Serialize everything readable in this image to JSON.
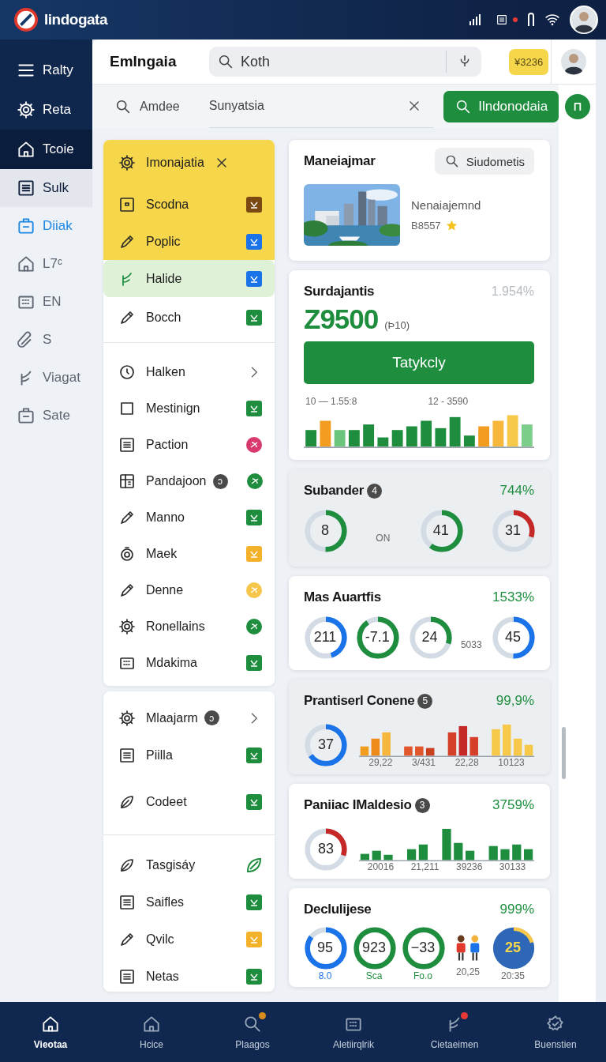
{
  "top_bar": {
    "app_name": "Iindogata"
  },
  "sidebar": {
    "sections": [
      {
        "kind": "dark",
        "items": [
          {
            "label": "Ralty",
            "selected": false,
            "highlighted": false,
            "accent": false
          },
          {
            "label": "Reta",
            "selected": false,
            "highlighted": false,
            "accent": false
          },
          {
            "label": "Tcoie",
            "selected": true,
            "highlighted": false,
            "accent": false
          }
        ]
      },
      {
        "kind": "light",
        "items": [
          {
            "label": "Sulk",
            "selected": false,
            "highlighted": true,
            "accent": false
          },
          {
            "label": "Diiak",
            "selected": false,
            "highlighted": false,
            "accent": true
          },
          {
            "label": "L7ᶜ",
            "selected": false,
            "highlighted": false,
            "accent": false
          },
          {
            "label": "EN",
            "selected": false,
            "highlighted": false,
            "accent": false
          },
          {
            "label": "S",
            "selected": false,
            "highlighted": false,
            "accent": false
          },
          {
            "label": "Viagat",
            "selected": false,
            "highlighted": false,
            "accent": false
          },
          {
            "label": "Sate",
            "selected": false,
            "highlighted": false,
            "accent": false
          }
        ]
      }
    ]
  },
  "header": {
    "title": "EmIngaia",
    "search": {
      "value": "Koth"
    },
    "badge": "¥3236"
  },
  "filter_bar": {
    "label": "Amdee",
    "field": {
      "value": "Sunyatsia"
    },
    "button": "Ilndonodaia"
  },
  "lists": [
    {
      "header": {
        "title": "Imonajatia"
      },
      "groups": [
        [
          {
            "label": "Scodna",
            "kind": "banner",
            "selected": false,
            "trail": {
              "kind": "square",
              "color": "#7a4a12"
            }
          },
          {
            "label": "Poplic",
            "kind": "banner",
            "selected": false,
            "trail": {
              "kind": "square",
              "color": "#1a73e8"
            }
          },
          {
            "label": "Halide",
            "kind": "plain",
            "selected": true,
            "trail": {
              "kind": "square",
              "color": "#1a73e8"
            }
          },
          {
            "label": "Bocch",
            "kind": "plain",
            "selected": false,
            "trail": {
              "kind": "square",
              "color": "#1e8e3e"
            }
          }
        ],
        [
          {
            "label": "Halken",
            "kind": "plain",
            "selected": false,
            "trail": {
              "kind": "chevron"
            }
          },
          {
            "label": "Mestinign",
            "kind": "plain",
            "selected": false,
            "trail": {
              "kind": "square",
              "color": "#1e8e3e"
            }
          },
          {
            "label": "Paction",
            "kind": "plain",
            "selected": false,
            "trail": {
              "kind": "circle",
              "color": "#d93a6e"
            }
          },
          {
            "label": "Pandajoon",
            "badge": "ɔ",
            "kind": "plain",
            "selected": false,
            "trail": {
              "kind": "circle",
              "color": "#1e8e3e"
            }
          },
          {
            "label": "Manno",
            "kind": "plain",
            "selected": false,
            "trail": {
              "kind": "square",
              "color": "#1e8e3e"
            }
          },
          {
            "label": "Maek",
            "kind": "plain",
            "selected": false,
            "trail": {
              "kind": "square",
              "color": "#f4b22b"
            }
          },
          {
            "label": "Denne",
            "kind": "plain",
            "selected": false,
            "trail": {
              "kind": "circle",
              "color": "#f6c64a"
            }
          },
          {
            "label": "Ronellains",
            "kind": "plain",
            "selected": false,
            "trail": {
              "kind": "circle",
              "color": "#1e8e3e"
            }
          },
          {
            "label": "Mdakima",
            "kind": "plain",
            "selected": false,
            "trail": {
              "kind": "square",
              "color": "#1e8e3e"
            }
          }
        ]
      ]
    },
    {
      "groups": [
        [
          {
            "label": "Mlaajarm",
            "badge": "ɔ",
            "kind": "plain",
            "selected": false,
            "trail": {
              "kind": "chevron"
            }
          },
          {
            "label": "Piilla",
            "kind": "plain",
            "selected": false,
            "trail": {
              "kind": "square",
              "color": "#1e8e3e"
            }
          },
          {
            "label": "Codeet",
            "kind": "plain",
            "selected": false,
            "trail": {
              "kind": "square",
              "color": "#1e8e3e"
            }
          }
        ],
        [
          {
            "label": "Tasgisáy",
            "kind": "plain",
            "selected": false,
            "trail": {
              "kind": "leaf",
              "color": "#1e8e3e"
            }
          },
          {
            "label": "Saifles",
            "kind": "plain",
            "selected": false,
            "trail": {
              "kind": "square",
              "color": "#1e8e3e"
            }
          },
          {
            "label": "Qvilc",
            "kind": "plain",
            "selected": false,
            "trail": {
              "kind": "square",
              "color": "#f4b22b"
            }
          },
          {
            "label": "Netas",
            "kind": "plain",
            "selected": false,
            "trail": {
              "kind": "square",
              "color": "#1e8e3e"
            }
          }
        ]
      ]
    }
  ],
  "cards": [
    {
      "kind": "media",
      "shaded": false,
      "title": "Maneiajmar",
      "action": "Siudometis",
      "name": "Nenaiajemnd",
      "code": "B8557"
    },
    {
      "kind": "stat",
      "shaded": false,
      "title": "Surdajantis",
      "change": "1.954%",
      "value": "Z9500",
      "unit": "(Þ10)",
      "button": "Tatykcly",
      "labels": [
        "10 — 1.55:8",
        "12 - 3590"
      ]
    },
    {
      "kind": "gauges",
      "shaded": true,
      "title": "Subander",
      "badge": "4",
      "change": "744%",
      "items": [
        {
          "kind": "ring",
          "value": "8",
          "color": "#1e8e3e"
        },
        {
          "kind": "note",
          "text": "ON"
        },
        {
          "kind": "ring",
          "value": "41",
          "color": "#1e8e3e"
        },
        {
          "kind": "ring",
          "value": "31",
          "color": "#c62828"
        }
      ]
    },
    {
      "kind": "gauges",
      "shaded": false,
      "title": "Mas Auartfis",
      "change": "1533%",
      "items": [
        {
          "kind": "ring",
          "value": "211",
          "color": "#1a73e8"
        },
        {
          "kind": "ring",
          "value": "-7.1",
          "color": "#1e8e3e"
        },
        {
          "kind": "ring",
          "value": "24",
          "color": "#1e8e3e"
        },
        {
          "kind": "note",
          "text": "5033"
        },
        {
          "kind": "ring",
          "value": "45",
          "color": "#1a73e8"
        }
      ]
    },
    {
      "kind": "combo",
      "shaded": true,
      "title": "Prantiserl Conene",
      "badge": "5",
      "change": "99,9%",
      "gauge": {
        "value": "37",
        "color": "#1a73e8"
      },
      "labels": [
        "29,22",
        "3/431",
        "22,28",
        "10123"
      ]
    },
    {
      "kind": "combo",
      "shaded": false,
      "title": "Paniiac IMaldesio",
      "badge": "3",
      "change": "3759%",
      "gauge": {
        "value": "83",
        "color": "#c62828"
      },
      "labels": [
        "20016",
        "21,211",
        "39236",
        "30133"
      ]
    },
    {
      "kind": "gauges",
      "shaded": false,
      "title": "Declulijese",
      "change": "999%",
      "items": [
        {
          "kind": "ring",
          "value": "95",
          "color": "#1a73e8",
          "caption": "8.0"
        },
        {
          "kind": "ring",
          "value": "923",
          "color": "#1e8e3e",
          "caption": "Sca"
        },
        {
          "kind": "ring",
          "value": "−33",
          "color": "#1e8e3e",
          "caption": "Fo.o"
        },
        {
          "kind": "figures",
          "caption": "20,25"
        },
        {
          "kind": "disc",
          "value": "25",
          "color": "#2f67b7",
          "caption": "20:35"
        }
      ]
    }
  ],
  "bottom_nav": [
    {
      "label": "Vieotaa",
      "selected": true
    },
    {
      "label": "Hcice",
      "selected": false
    },
    {
      "label": "Plaagos",
      "selected": false,
      "color": "#d98a1f"
    },
    {
      "label": "Aletiirqlrik",
      "selected": false
    },
    {
      "label": "Cietaeimen",
      "selected": false,
      "color": "#e53935"
    },
    {
      "label": "Buenstien",
      "selected": false
    }
  ]
}
